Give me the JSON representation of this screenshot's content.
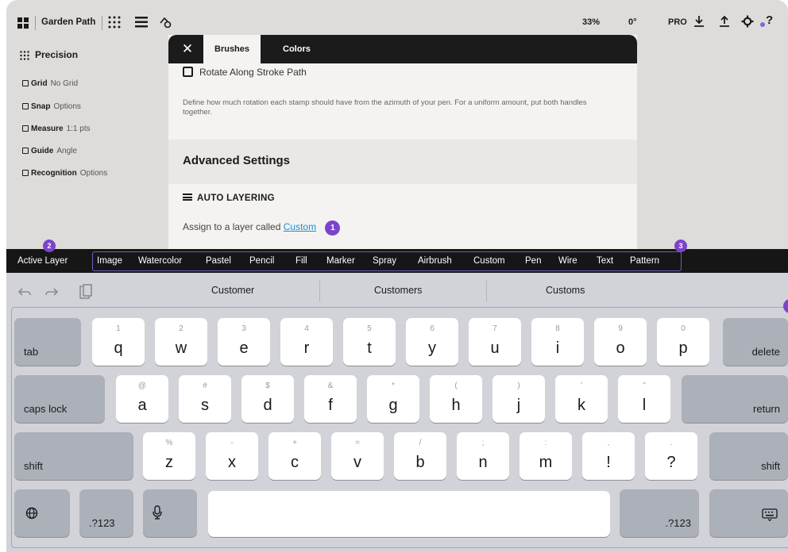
{
  "topbar": {
    "doc_name": "Garden Path",
    "zoom": "33%",
    "angle": "0°",
    "pro": "PRO",
    "help": "?"
  },
  "precision": {
    "title": "Precision",
    "items": [
      {
        "label": "Grid",
        "sub": "No Grid"
      },
      {
        "label": "Snap",
        "sub": "Options"
      },
      {
        "label": "Measure",
        "sub": "1:1 pts"
      },
      {
        "label": "Guide",
        "sub": "Angle"
      },
      {
        "label": "Recognition",
        "sub": "Options"
      }
    ]
  },
  "dialog": {
    "close": "✕",
    "tabs": [
      "Brushes",
      "Colors"
    ],
    "rotate_checkbox": "Rotate Along Stroke Path",
    "description": "Define how much rotation each stamp should have from the azimuth of your pen. For a uniform amount, put both handles together.",
    "advanced_title": "Advanced Settings",
    "auto_layering_title": "AUTO LAYERING",
    "assign_text": "Assign to a layer called",
    "assign_link": "Custom",
    "marker_1": "1"
  },
  "brush_strip": {
    "active": "Active Layer",
    "items": [
      "Image",
      "Watercolor",
      "Pastel",
      "Pencil",
      "Fill",
      "Marker",
      "Spray",
      "Airbrush",
      "Custom",
      "Pen",
      "Wire",
      "Text",
      "Pattern"
    ],
    "marker_2": "2",
    "marker_3": "3"
  },
  "keyboard": {
    "suggestions": [
      "Customer",
      "Customers",
      "Customs"
    ],
    "row1": [
      {
        "k": "q",
        "a": "1"
      },
      {
        "k": "w",
        "a": "2"
      },
      {
        "k": "e",
        "a": "3"
      },
      {
        "k": "r",
        "a": "4"
      },
      {
        "k": "t",
        "a": "5"
      },
      {
        "k": "y",
        "a": "6"
      },
      {
        "k": "u",
        "a": "7"
      },
      {
        "k": "i",
        "a": "8"
      },
      {
        "k": "o",
        "a": "9"
      },
      {
        "k": "p",
        "a": "0"
      }
    ],
    "row2": [
      {
        "k": "a",
        "a": "@"
      },
      {
        "k": "s",
        "a": "#"
      },
      {
        "k": "d",
        "a": "$"
      },
      {
        "k": "f",
        "a": "&"
      },
      {
        "k": "g",
        "a": "*"
      },
      {
        "k": "h",
        "a": "("
      },
      {
        "k": "j",
        "a": ")"
      },
      {
        "k": "k",
        "a": "'"
      },
      {
        "k": "l",
        "a": "\""
      }
    ],
    "row3": [
      {
        "k": "z",
        "a": "%"
      },
      {
        "k": "x",
        "a": "-"
      },
      {
        "k": "c",
        "a": "+"
      },
      {
        "k": "v",
        "a": "="
      },
      {
        "k": "b",
        "a": "/"
      },
      {
        "k": "n",
        "a": ";"
      },
      {
        "k": "m",
        "a": ":"
      },
      {
        "k": "!",
        "a": ","
      },
      {
        "k": "?",
        "a": "."
      }
    ],
    "tab": "tab",
    "delete": "delete",
    "caps_lock": "caps lock",
    "return": "return",
    "shift": "shift",
    "num": ".?123"
  }
}
